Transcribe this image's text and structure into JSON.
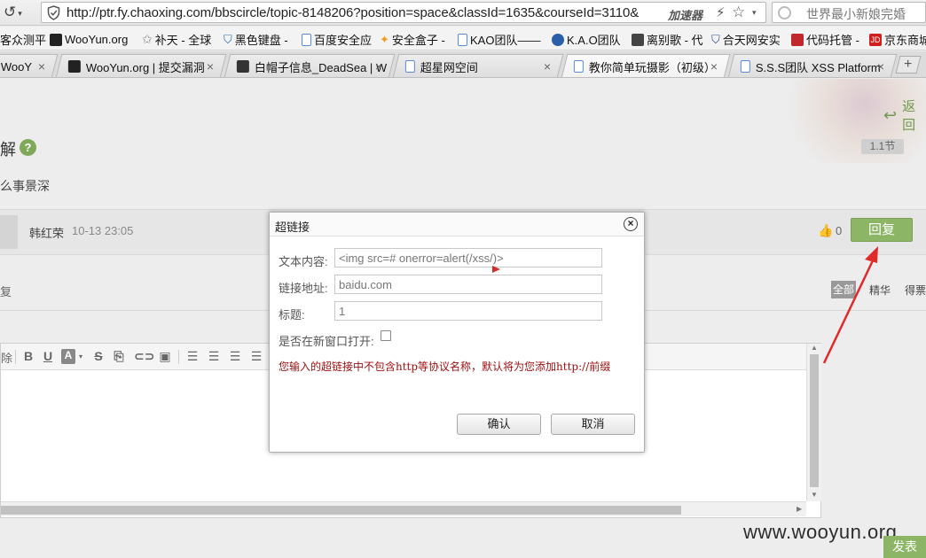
{
  "browser": {
    "back_glyph": "↺",
    "url": "http://ptr.fy.chaoxing.com/bbscircle/topic-8148206?position=space&classId=1635&courseId=3110&",
    "accelerator_label": "加速器",
    "search_placeholder": "世界最小新娘完婚",
    "bookmarks": [
      {
        "label": "客众测平",
        "color": "#3a78c2"
      },
      {
        "label": "WooYun.org",
        "color": "#222222"
      },
      {
        "label": "补天 - 全球",
        "color": "#888888"
      },
      {
        "label": "黑色键盘 -",
        "color": "#2a6db5"
      },
      {
        "label": "百度安全应",
        "color": "#5b8ad6"
      },
      {
        "label": "安全盒子 -",
        "color": "#f0a020"
      },
      {
        "label": "KAO团队——",
        "color": "#5b8ad6"
      },
      {
        "label": "K.A.O团队",
        "color": "#2b5fa8"
      },
      {
        "label": "离别歌 - 代",
        "color": "#444444"
      },
      {
        "label": "合天网安实",
        "color": "#2a4f8f"
      },
      {
        "label": "代码托管 -",
        "color": "#c0282d"
      },
      {
        "label": "京东商城",
        "color": "#d11e1e"
      }
    ],
    "tabs": [
      {
        "label": "WooY",
        "color": "#222222"
      },
      {
        "label": "WooYun.org | 提交漏洞",
        "color": "#222222"
      },
      {
        "label": "白帽子信息_DeadSea | W",
        "color": "#333333"
      },
      {
        "label": "超星网空间",
        "color": "#5b8ad6"
      },
      {
        "label": "教你简单玩摄影（初级）",
        "color": "#5b8ad6"
      },
      {
        "label": "S.S.S团队 XSS Platform",
        "color": "#5b8ad6"
      }
    ],
    "new_tab_glyph": "+"
  },
  "page": {
    "back_label": "返回",
    "title_fragment": "解",
    "help_glyph": "?",
    "section_badge": "1.1节",
    "subtitle_fragment": "么事景深",
    "post": {
      "author": "韩红荣",
      "time": "10-13 23:05",
      "like_count": "0",
      "reply_label": "回复"
    },
    "reply_fragment": "复",
    "filters": {
      "all": "全部",
      "best": "精华",
      "praise": "得票"
    },
    "toolbar": {
      "cut_label": "除",
      "bold": "B",
      "underline": "U",
      "color": "A",
      "strike": "S"
    },
    "publish_label": "发表",
    "watermark": "www.wooyun.org"
  },
  "dialog": {
    "title": "超链接",
    "close_glyph": "×",
    "text_label": "文本内容:",
    "text_value": "<img src=# onerror=alert(/xss/)>",
    "url_label": "链接地址:",
    "url_value": "baidu.com",
    "title_label": "标题:",
    "title_value": "1",
    "newwin_label": "是否在新窗口打开:",
    "newwin_checked": false,
    "warning": "您输入的超链接中不包含http等协议名称，默认将为您添加http://前缀",
    "ok_label": "确认",
    "cancel_label": "取消"
  },
  "colors": {
    "accent_green": "#8cb565",
    "warning_red": "#a01010",
    "annotation_red": "#e02a2a"
  }
}
